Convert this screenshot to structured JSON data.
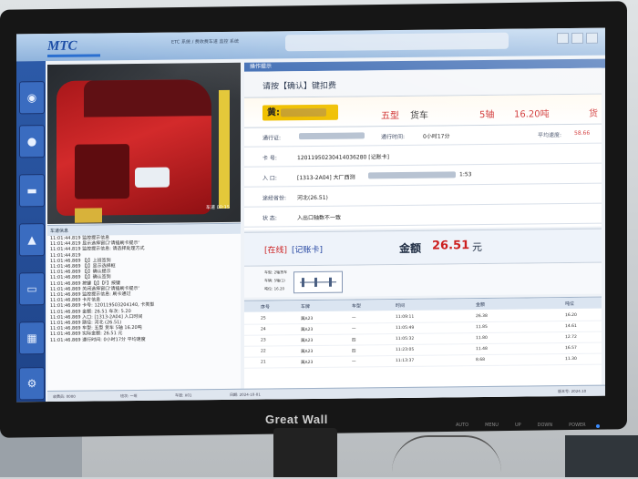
{
  "titlebar": {
    "logo": "MTC",
    "system_text": "ETC 系统 / 费收费车道 监控 系统"
  },
  "navigation": {
    "icons": [
      "camera-icon",
      "coin-icon",
      "vehicle-icon",
      "barrier-icon",
      "card-icon",
      "printer-icon",
      "settings-icon"
    ]
  },
  "camera": {
    "timestamp": "车道 00:15"
  },
  "log": {
    "title": "车道信息",
    "lines": [
      "11:01:44.819 监控提示信息",
      "11:01:44.819 显示选择窗口'请插刷卡提示'",
      "11:01:44.819 监控提示信息: 请选择处理方式",
      "11:01:44.819",
      "11:01:46.869 【J】上班签到",
      "11:01:46.869 【J】显示选择框",
      "11:01:46.869 【J】确认提示",
      "11:01:46.869 【J】确认签到",
      "11:01:46.869 按键【J】【F】按键",
      "11:01:46.869 关闭选择窗口'请插刷卡提示'",
      "11:01:46.869 监控提示信息: 刷卡通过",
      "11:01:46.869 卡片信息",
      "11:01:46.869 卡号: 120119503204140, 卡类型",
      "11:01:46.869 金额: 26.51 车次: 5.20",
      "11:01:46.869 入口: [1313-2A04] 入口时间",
      "11:01:46.869 路径: 河北 (26.51)",
      "11:01:46.869 车型: 五型 货车 5轴 16.20吨",
      "11:01:46.869 实际金额: 26.51 元",
      "11:01:46.869 通行时间: 0小时17分 平均速度"
    ]
  },
  "panel": {
    "header": "操作提示",
    "prompt": "请按【确认】键扣费",
    "vehicle": {
      "plate_prefix": "黄:",
      "class": "五型",
      "category": "货车",
      "axles": "5轴",
      "weight": "16.20吨",
      "extra": "货"
    },
    "fields": {
      "pass_label": "通行证:",
      "pass_time_label": "通行时间:",
      "pass_time_value": "0小时17分",
      "avg_speed_label": "平均速度:",
      "avg_speed_value": "58.66",
      "card_label": "卡  号:",
      "card_value": "12011950230414036280 [记账卡]",
      "entry_label": "入  口:",
      "entry_value": "[1313-2A04] 大厂西测",
      "entry_time_tail": "1:53",
      "route_label": "途经省份:",
      "route_value": "河北(26.51)",
      "status_label": "状  态:",
      "status_value": "入出口轴数不一致"
    },
    "payment": {
      "online": "[在线]",
      "card_type": "[记账卡]",
      "amount_label": "金额",
      "amount_value": "26.51",
      "amount_unit": "元"
    },
    "axle": {
      "line1": "车型: 2轴货车",
      "line2": "车辆: 5轴(1)",
      "line3": "吨位: 16.20"
    },
    "table": {
      "headers": [
        "序号",
        "车牌",
        "车型",
        "时间",
        "金额",
        "吨位"
      ],
      "rows": [
        [
          "25",
          "冀A23",
          "一",
          "11:09:11",
          "26.38",
          "16.20"
        ],
        [
          "24",
          "冀A23",
          "一",
          "11:05:49",
          "11.85",
          "14.61"
        ],
        [
          "23",
          "冀A23",
          "四",
          "11:05:32",
          "11.80",
          "12.72"
        ],
        [
          "22",
          "冀A23",
          "四",
          "11:23:05",
          "11.48",
          "16.57"
        ],
        [
          "21",
          "冀A23",
          "一",
          "11:13:37",
          "8.68",
          "11.30"
        ]
      ]
    }
  },
  "statusbar": {
    "items": [
      "收费员: 0000",
      "班次: 一班",
      "车道: X01",
      "日期: 2024-10-01",
      "版本号: 2024.10"
    ]
  },
  "monitor": {
    "brand": "Great Wall",
    "buttons": [
      "AUTO",
      "MENU",
      "UP",
      "DOWN",
      "POWER"
    ]
  }
}
